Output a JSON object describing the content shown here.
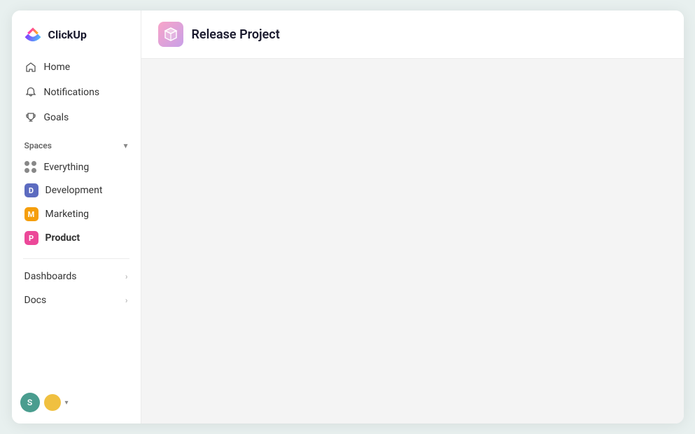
{
  "logo": {
    "text": "ClickUp"
  },
  "sidebar": {
    "nav": [
      {
        "id": "home",
        "label": "Home",
        "icon": "home"
      },
      {
        "id": "notifications",
        "label": "Notifications",
        "icon": "bell"
      },
      {
        "id": "goals",
        "label": "Goals",
        "icon": "trophy"
      }
    ],
    "spaces_label": "Spaces",
    "spaces": [
      {
        "id": "everything",
        "label": "Everything",
        "type": "dots"
      },
      {
        "id": "development",
        "label": "Development",
        "type": "avatar",
        "letter": "D",
        "color": "#5c6bc0"
      },
      {
        "id": "marketing",
        "label": "Marketing",
        "type": "avatar",
        "letter": "M",
        "color": "#f59e0b"
      },
      {
        "id": "product",
        "label": "Product",
        "type": "avatar",
        "letter": "P",
        "color": "#ec4899",
        "active": true
      }
    ],
    "sections": [
      {
        "id": "dashboards",
        "label": "Dashboards"
      },
      {
        "id": "docs",
        "label": "Docs"
      }
    ]
  },
  "main": {
    "project_title": "Release Project",
    "project_icon_label": "box-icon"
  }
}
